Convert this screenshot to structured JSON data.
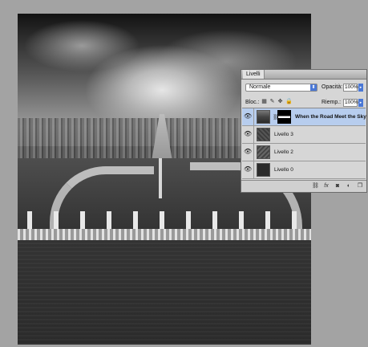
{
  "panel": {
    "tab_label": "Livelli",
    "blend_mode": "Normale",
    "opacity_label": "Opacità:",
    "opacity_value": "100%",
    "lock_label": "Bloc.:",
    "fill_label": "Riemp.:",
    "fill_value": "100%",
    "lock_icons": [
      "lock-transparency-icon",
      "lock-paint-icon",
      "lock-move-icon",
      "lock-all-icon"
    ],
    "layers": [
      {
        "name": "When the Road Meet the Sky",
        "selected": true,
        "thumb": "photo",
        "has_mask": true
      },
      {
        "name": "Livello 3",
        "selected": false,
        "thumb": "texture"
      },
      {
        "name": "Livello 2",
        "selected": false,
        "thumb": "texture2"
      },
      {
        "name": "Livello 0",
        "selected": false,
        "thumb": "dark"
      }
    ],
    "footer_icons": [
      "link-layers-icon",
      "fx-icon",
      "add-mask-icon",
      "adjustment-layer-icon",
      "new-layer-icon"
    ]
  },
  "colors": {
    "selection": "#b7cdee",
    "accent": "#4a78d6",
    "workspace": "#a3a3a3"
  }
}
